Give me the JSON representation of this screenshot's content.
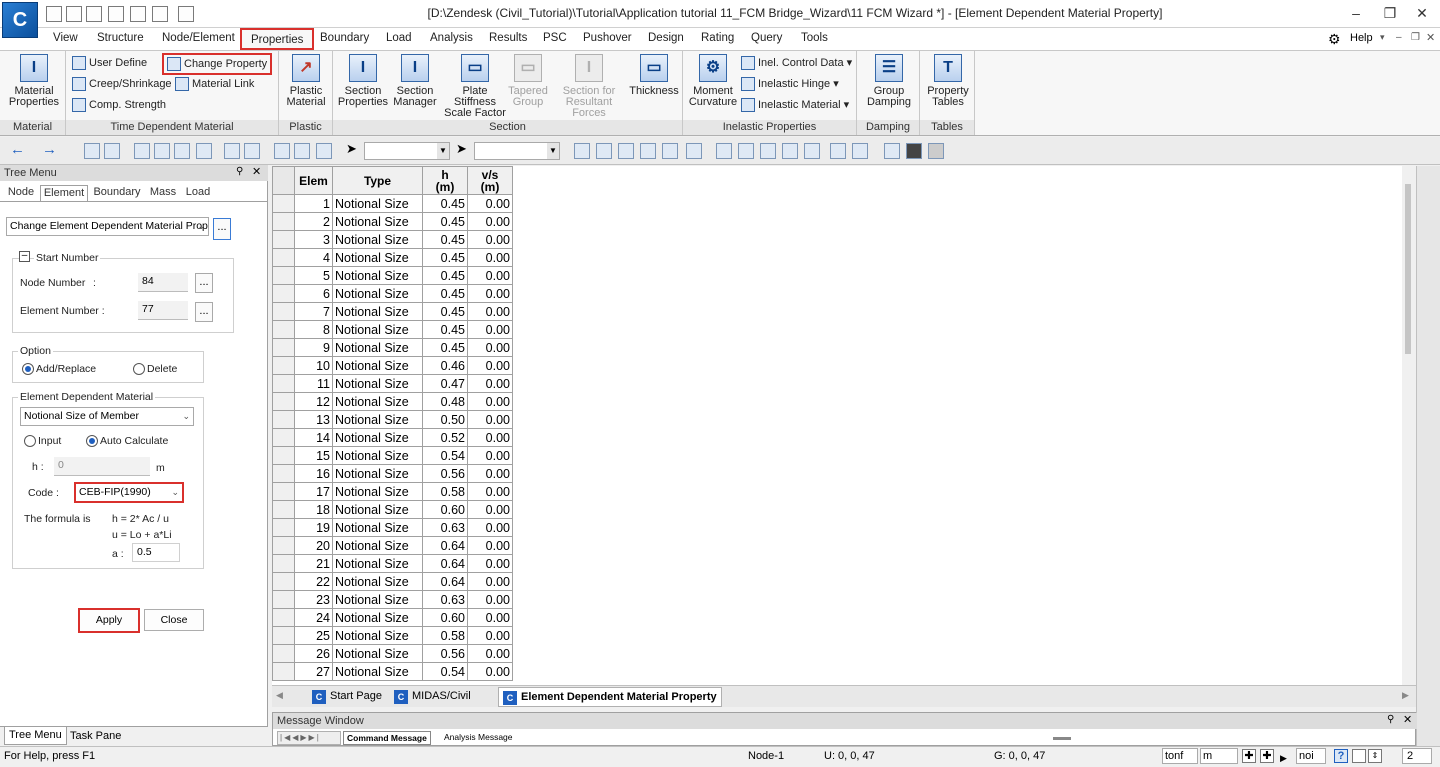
{
  "app": {
    "logo": "C",
    "title": "[D:\\Zendesk (Civil_Tutorial)\\Tutorial\\Application tutorial 11_FCM Bridge_Wizard\\11 FCM Wizard *] - [Element Dependent Material Property]",
    "help": "Help"
  },
  "menu": {
    "tabs": [
      "View",
      "Structure",
      "Node/Element",
      "Properties",
      "Boundary",
      "Load",
      "Analysis",
      "Results",
      "PSC",
      "Pushover",
      "Design",
      "Rating",
      "Query",
      "Tools"
    ],
    "active": "Properties"
  },
  "ribbon": {
    "material": {
      "caption": "Material",
      "btn": "Material Properties"
    },
    "tdm": {
      "caption": "Time Dependent Material",
      "user_define": "User Define",
      "creep": "Creep/Shrinkage",
      "comp": "Comp. Strength",
      "change": "Change Property",
      "link": "Material Link"
    },
    "plastic": {
      "caption": "Plastic",
      "btn": "Plastic Material"
    },
    "section": {
      "caption": "Section",
      "b1": "Section Properties",
      "b2": "Section Manager",
      "b3": "Plate Stiffness Scale Factor",
      "b4": "Tapered Group",
      "b5": "Section for Resultant Forces",
      "b6": "Thickness"
    },
    "inelastic": {
      "caption": "Inelastic Properties",
      "b1": "Moment Curvature",
      "s1": "Inel. Control Data",
      "s2": "Inelastic Hinge",
      "s3": "Inelastic Material"
    },
    "damping": {
      "caption": "Damping",
      "btn": "Group Damping"
    },
    "tables": {
      "caption": "Tables",
      "btn": "Property Tables"
    }
  },
  "tree": {
    "header": "Tree Menu",
    "tabs": [
      "Node",
      "Element",
      "Boundary",
      "Mass",
      "Load"
    ],
    "active_tab": "Element",
    "function_combo": "Change Element Dependent Material Prope",
    "start_number": "Start Number",
    "node_number_label": "Node Number",
    "node_number": "84",
    "element_number_label": "Element Number :",
    "element_number": "77",
    "option": "Option",
    "add_replace": "Add/Replace",
    "delete": "Delete",
    "edm": "Element Dependent Material",
    "edm_combo": "Notional Size of Member",
    "input": "Input",
    "auto_calc": "Auto Calculate",
    "h_label": "h :",
    "h_value": "0",
    "h_unit": "m",
    "code_label": "Code :",
    "code_value": "CEB-FIP(1990)",
    "formula_label": "The formula is",
    "formula1": "h = 2* Ac / u",
    "formula2": "u = Lo + a*Li",
    "a_label": "a :",
    "a_value": "0.5",
    "apply": "Apply",
    "close": "Close",
    "bottom_tabs": [
      "Tree Menu",
      "Task Pane"
    ]
  },
  "grid": {
    "headers": [
      "Elem",
      "Type",
      "h\n(m)",
      "v/s\n(m)"
    ],
    "rows": [
      [
        "1",
        "Notional Size",
        "0.45",
        "0.00"
      ],
      [
        "2",
        "Notional Size",
        "0.45",
        "0.00"
      ],
      [
        "3",
        "Notional Size",
        "0.45",
        "0.00"
      ],
      [
        "4",
        "Notional Size",
        "0.45",
        "0.00"
      ],
      [
        "5",
        "Notional Size",
        "0.45",
        "0.00"
      ],
      [
        "6",
        "Notional Size",
        "0.45",
        "0.00"
      ],
      [
        "7",
        "Notional Size",
        "0.45",
        "0.00"
      ],
      [
        "8",
        "Notional Size",
        "0.45",
        "0.00"
      ],
      [
        "9",
        "Notional Size",
        "0.45",
        "0.00"
      ],
      [
        "10",
        "Notional Size",
        "0.46",
        "0.00"
      ],
      [
        "11",
        "Notional Size",
        "0.47",
        "0.00"
      ],
      [
        "12",
        "Notional Size",
        "0.48",
        "0.00"
      ],
      [
        "13",
        "Notional Size",
        "0.50",
        "0.00"
      ],
      [
        "14",
        "Notional Size",
        "0.52",
        "0.00"
      ],
      [
        "15",
        "Notional Size",
        "0.54",
        "0.00"
      ],
      [
        "16",
        "Notional Size",
        "0.56",
        "0.00"
      ],
      [
        "17",
        "Notional Size",
        "0.58",
        "0.00"
      ],
      [
        "18",
        "Notional Size",
        "0.60",
        "0.00"
      ],
      [
        "19",
        "Notional Size",
        "0.63",
        "0.00"
      ],
      [
        "20",
        "Notional Size",
        "0.64",
        "0.00"
      ],
      [
        "21",
        "Notional Size",
        "0.64",
        "0.00"
      ],
      [
        "22",
        "Notional Size",
        "0.64",
        "0.00"
      ],
      [
        "23",
        "Notional Size",
        "0.63",
        "0.00"
      ],
      [
        "24",
        "Notional Size",
        "0.60",
        "0.00"
      ],
      [
        "25",
        "Notional Size",
        "0.58",
        "0.00"
      ],
      [
        "26",
        "Notional Size",
        "0.56",
        "0.00"
      ],
      [
        "27",
        "Notional Size",
        "0.54",
        "0.00"
      ]
    ]
  },
  "doc_tabs": [
    "Start Page",
    "MIDAS/Civil",
    "Element Dependent Material Property"
  ],
  "message": {
    "header": "Message Window",
    "tabs": [
      "Command Message",
      "Analysis Message"
    ]
  },
  "status": {
    "help": "For Help, press F1",
    "node": "Node-1",
    "u": "U: 0, 0, 47",
    "g": "G: 0, 0, 47",
    "force_unit": "tonf",
    "length_unit": "m",
    "mode": "noi",
    "page": "2"
  }
}
